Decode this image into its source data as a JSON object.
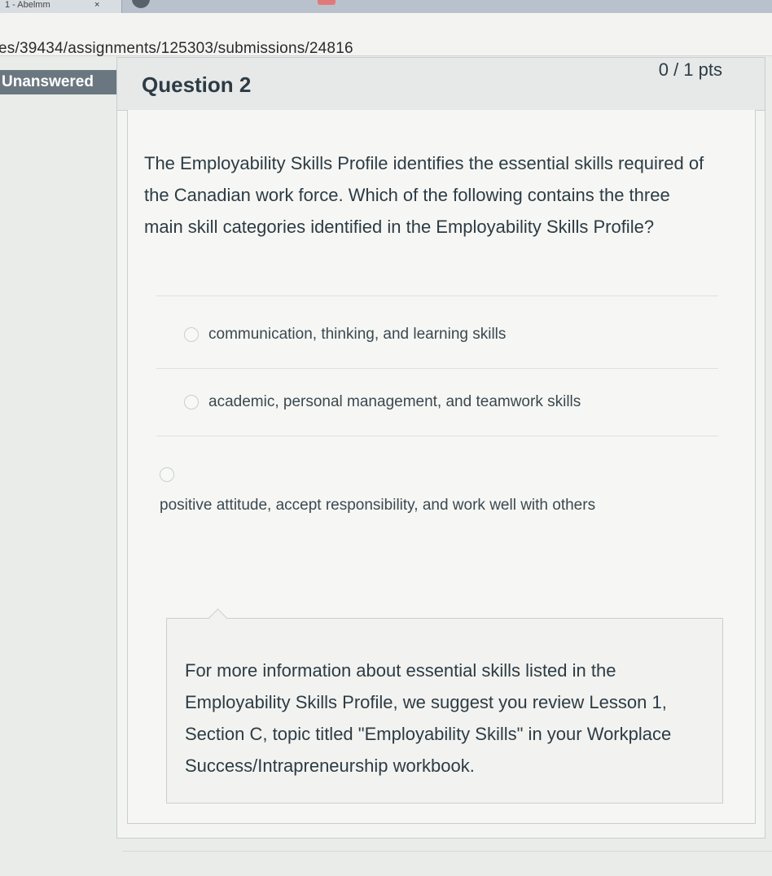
{
  "browser": {
    "tab_title": "1 - Abelmm",
    "tab_close": "×",
    "url": "es/39434/assignments/125303/submissions/24816"
  },
  "question": {
    "status_badge": "Unanswered",
    "title": "Question 2",
    "points": "0 / 1 pts",
    "text": "The Employability Skills Profile identifies the essential skills required of the Canadian work force. Which of the following contains the three main skill categories identified in the Employability Skills Profile?",
    "answers": [
      {
        "label": "communication, thinking, and learning skills"
      },
      {
        "label": "academic, personal management, and teamwork skills"
      },
      {
        "label": "positive attitude, accept responsibility, and work well with others"
      }
    ],
    "feedback": "For more information about essential skills listed in the Employability Skills Profile, we suggest you review Lesson 1, Section C, topic titled \"Employability Skills\" in your Workplace Success/Intrapreneurship workbook."
  },
  "colors": {
    "badge_bg": "#6b7780",
    "text": "#2d3b45",
    "header_bg": "#e6e9e8"
  }
}
